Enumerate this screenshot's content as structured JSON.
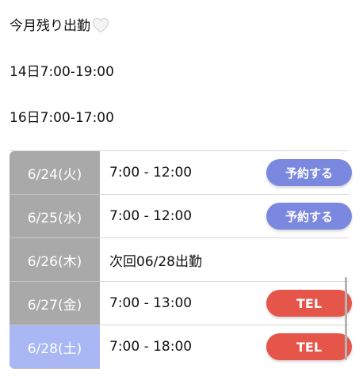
{
  "notice": {
    "title": "今月残り出勤",
    "heart_icon": "white-heart-icon",
    "line1": "14日7:00-19:00",
    "line2": "16日7:00-17:00"
  },
  "colors": {
    "date_bg": "#a9a9a9",
    "date_today_bg": "#a9b7f5",
    "reserve_button": "#7b88e0",
    "tel_button": "#e5554a"
  },
  "schedule": [
    {
      "date": "6/24(火)",
      "time": "7:00 - 12:00",
      "action": "予約する"
    },
    {
      "date": "6/25(水)",
      "time": "7:00 - 12:00",
      "action": "予約する"
    },
    {
      "date": "6/26(木)",
      "time": "次回06/28出勤",
      "action": ""
    },
    {
      "date": "6/27(金)",
      "time": "7:00 - 13:00",
      "action": "TEL"
    },
    {
      "date": "6/28(土)",
      "time": "7:00 - 18:00",
      "action": "TEL"
    }
  ]
}
